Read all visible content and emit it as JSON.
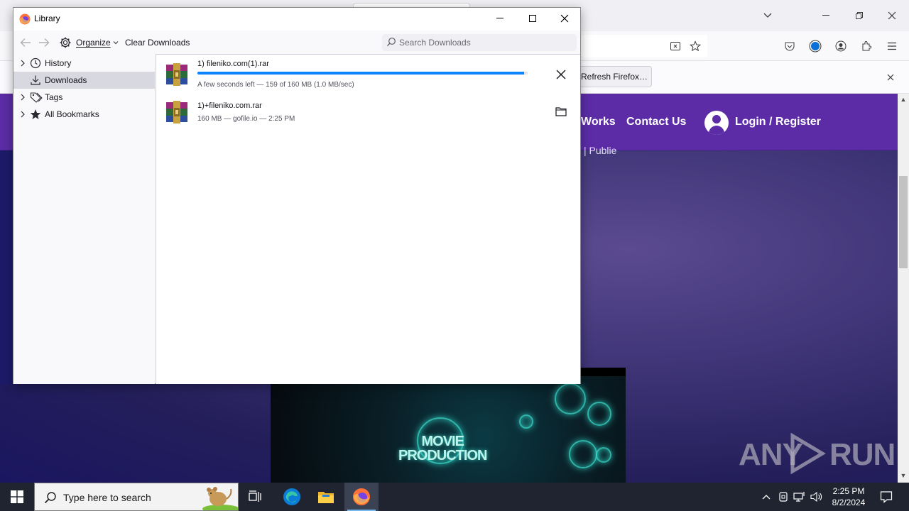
{
  "library": {
    "title": "Library",
    "toolbar": {
      "organize_label": "Organize",
      "clear_downloads_label": "Clear Downloads",
      "search_placeholder": "Search Downloads"
    },
    "sidebar": {
      "items": [
        {
          "label": "History",
          "icon": "clock-icon",
          "expandable": true
        },
        {
          "label": "Downloads",
          "icon": "download-icon",
          "expandable": false,
          "selected": true
        },
        {
          "label": "Tags",
          "icon": "tag-icon",
          "expandable": true
        },
        {
          "label": "All Bookmarks",
          "icon": "star-icon",
          "expandable": true
        }
      ]
    },
    "downloads": [
      {
        "name": "1) fileniko.com(1).rar",
        "status": "A few seconds left — 159 of 160 MB (1.0 MB/sec)",
        "progress": 0.99,
        "in_progress": true,
        "action": "cancel-icon"
      },
      {
        "name": "1)+fileniko.com.rar",
        "status": "160 MB — gofile.io — 2:25 PM",
        "in_progress": false,
        "action": "folder-icon"
      }
    ]
  },
  "browser": {
    "notification_button": "Refresh Firefox…",
    "site_nav": {
      "link_works": "Works",
      "link_contact": "Contact Us",
      "link_login": "Login / Register",
      "subtext": "| Publie"
    },
    "video_title_line1": "MOVIE",
    "video_title_line2": "PRODUCTION",
    "watermark_left": "ANY",
    "watermark_right": "RUN"
  },
  "taskbar": {
    "search_placeholder": "Type here to search",
    "time": "2:25 PM",
    "date": "8/2/2024"
  },
  "colors": {
    "accent": "#0a84ff",
    "site_nav": "#5b2ca6",
    "taskbar": "#1f2430"
  }
}
